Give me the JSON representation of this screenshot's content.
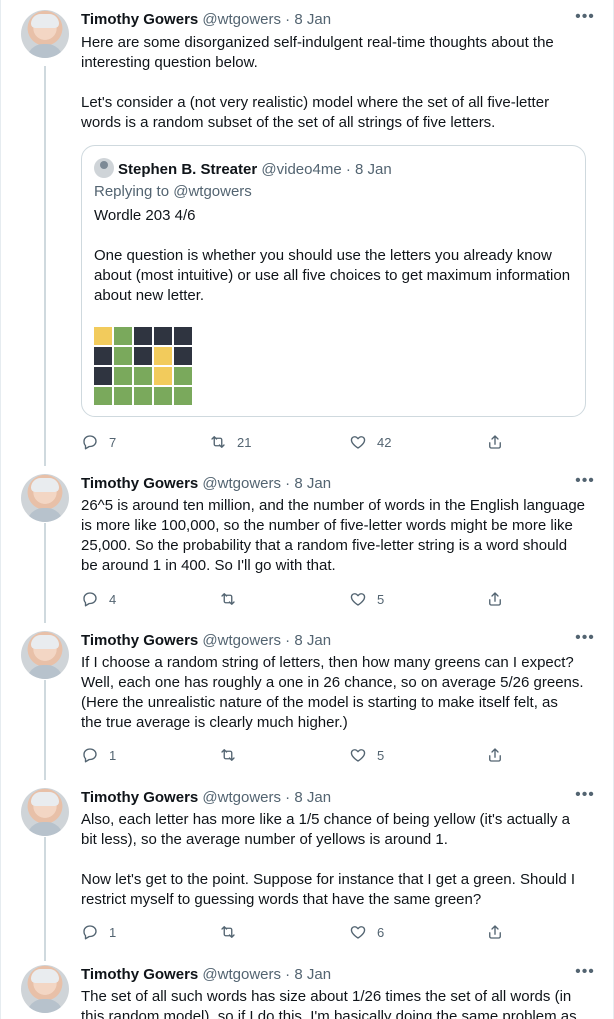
{
  "colors": {
    "green": "#7aa95c",
    "yellow": "#f2cb5c",
    "black": "#2f3440",
    "muted": "#536471",
    "border": "#cfd9de"
  },
  "tweets": [
    {
      "name": "Timothy Gowers",
      "handle": "@wtgowers",
      "date": "8 Jan",
      "sep": " · ",
      "text": "Here are some disorganized self-indulgent real-time thoughts about the\ninteresting question below.\n\nLet's consider a (not very realistic) model where the set of all five-letter\nwords is a random subset of the set of all strings of five letters.",
      "replies": "7",
      "retweets": "21",
      "likes": "42"
    },
    {
      "name": "Timothy Gowers",
      "handle": "@wtgowers",
      "date": "8 Jan",
      "sep": " · ",
      "text": "26^5 is around ten million, and the number of words in the English language\nis more like 100,000, so the number of five-letter words might be more like\n25,000. So the probability that a random five-letter string is a word should\nbe around 1 in 400. So I'll go with that.",
      "replies": "4",
      "retweets": "",
      "likes": "5"
    },
    {
      "name": "Timothy Gowers",
      "handle": "@wtgowers",
      "date": "8 Jan",
      "sep": " · ",
      "text": "If I choose a random string of letters, then how many greens can I expect?\nWell, each one has roughly a one in 26 chance, so on average 5/26 greens.\n(Here the unrealistic nature of the model is starting to make itself felt, as\nthe true average is clearly much higher.)",
      "replies": "1",
      "retweets": "",
      "likes": "5"
    },
    {
      "name": "Timothy Gowers",
      "handle": "@wtgowers",
      "date": "8 Jan",
      "sep": " · ",
      "text": "Also, each letter has more like a 1/5 chance of being yellow (it's actually a\nbit less), so the average number of yellows is around 1.\n\nNow let's get to the point. Suppose for instance that I get a green. Should I\nrestrict myself to guessing words that have the same green?",
      "replies": "1",
      "retweets": "",
      "likes": "6"
    },
    {
      "name": "Timothy Gowers",
      "handle": "@wtgowers",
      "date": "8 Jan",
      "sep": " · ",
      "text": "The set of all such words has size about 1/26 times the set of all words (in\nthis random model), so if I do this, I'm basically doing the same problem as",
      "replies": "",
      "retweets": "",
      "likes": ""
    }
  ],
  "quote": {
    "name": "Stephen B. Streater",
    "handle": "@video4me",
    "date": "8 Jan",
    "sep": " · ",
    "reply": "Replying to @wtgowers",
    "text": "Wordle 203 4/6\n\nOne question is whether you should use the letters you already know\nabout (most intuitive) or use all five choices to get maximum information\nabout new letter.",
    "wordle_grid": [
      [
        "yellow",
        "green",
        "black",
        "black",
        "black"
      ],
      [
        "black",
        "green",
        "black",
        "yellow",
        "black"
      ],
      [
        "black",
        "green",
        "green",
        "yellow",
        "green"
      ],
      [
        "green",
        "green",
        "green",
        "green",
        "green"
      ]
    ]
  }
}
